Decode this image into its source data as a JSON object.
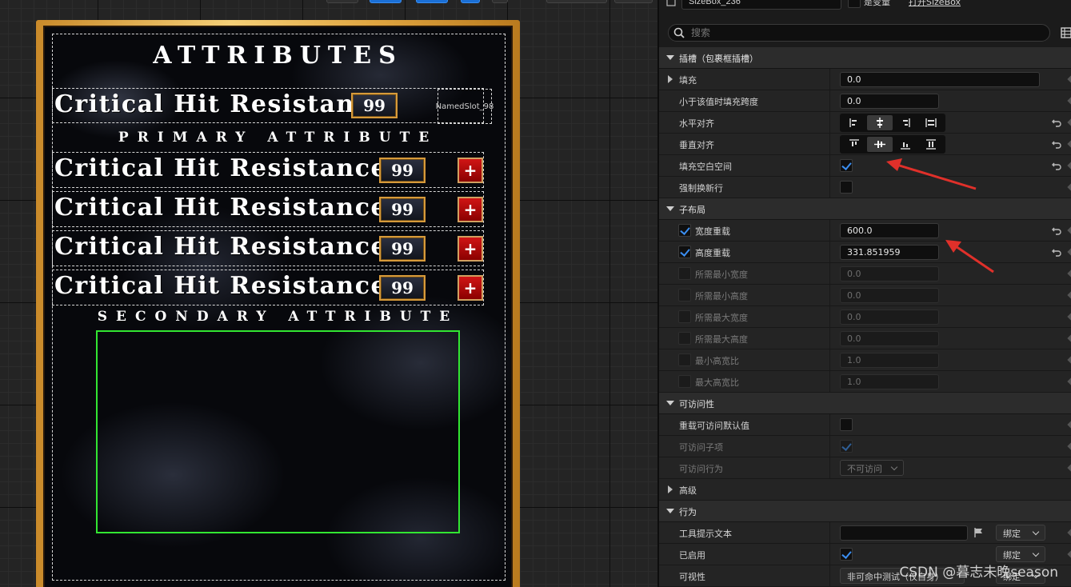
{
  "widget": {
    "title": "ATTRIBUTES",
    "top_row": {
      "label": "Critical Hit Resistance",
      "value": "99",
      "named_slot": "NamedSlot_98"
    },
    "primary_section": "PRIMARY ATTRIBUTE",
    "secondary_section": "SECONDARY ATTRIBUTE",
    "rows": [
      {
        "label": "Critical Hit Resistance",
        "value": "99",
        "button": "+"
      },
      {
        "label": "Critical Hit Resistance",
        "value": "99",
        "button": "+"
      },
      {
        "label": "Critical Hit Resistance",
        "value": "99",
        "button": "+"
      },
      {
        "label": "Critical Hit Resistance",
        "value": "99",
        "button": "+"
      }
    ]
  },
  "panel": {
    "name_field": "SizeBox_236",
    "is_variable_label": "是变量",
    "open_link": "打开SizeBox",
    "search_placeholder": "搜索",
    "slot_section": "插槽（包裹框插槽）",
    "fill": {
      "label": "填充",
      "value": "0.0"
    },
    "fill_span": {
      "label": "小于该值时填充跨度",
      "value": "0.0"
    },
    "h_align": {
      "label": "水平对齐",
      "active_index": 1
    },
    "v_align": {
      "label": "垂直对齐",
      "active_index": 1
    },
    "fill_empty": {
      "label": "填充空白空间",
      "checked": true
    },
    "force_newline": {
      "label": "强制换新行",
      "checked": false
    },
    "child_layout_section": "子布局",
    "width_override": {
      "label": "宽度重载",
      "value": "600.0",
      "checked": true
    },
    "height_override": {
      "label": "高度重载",
      "value": "331.851959",
      "checked": true
    },
    "min_desired_width": {
      "label": "所需最小宽度",
      "value": "0.0"
    },
    "min_desired_height": {
      "label": "所需最小高度",
      "value": "0.0"
    },
    "max_desired_width": {
      "label": "所需最大宽度",
      "value": "0.0"
    },
    "max_desired_height": {
      "label": "所需最大高度",
      "value": "0.0"
    },
    "min_aspect": {
      "label": "最小高宽比",
      "value": "1.0"
    },
    "max_aspect": {
      "label": "最大高宽比",
      "value": "1.0"
    },
    "accessibility_section": "可访问性",
    "override_access": {
      "label": "重载可访问默认值"
    },
    "access_children": {
      "label": "可访问子项"
    },
    "access_behavior": {
      "label": "可访问行为",
      "value": "不可访问"
    },
    "advanced_section": "高级",
    "behavior_section": "行为",
    "tooltip": {
      "label": "工具提示文本",
      "bind": "绑定"
    },
    "enabled": {
      "label": "已启用",
      "bind": "绑定"
    },
    "visibility": {
      "label": "可视性",
      "value": "非可命中测试（仅自身）",
      "bind": "绑定"
    }
  },
  "watermark": "CSDN @暮志未晚season",
  "colors": {
    "gold": "#e8b450",
    "green_outline": "#32e632",
    "accent_blue": "#3b8ef0",
    "plus_red": "#c00000",
    "annotation_red": "#e0302a"
  }
}
